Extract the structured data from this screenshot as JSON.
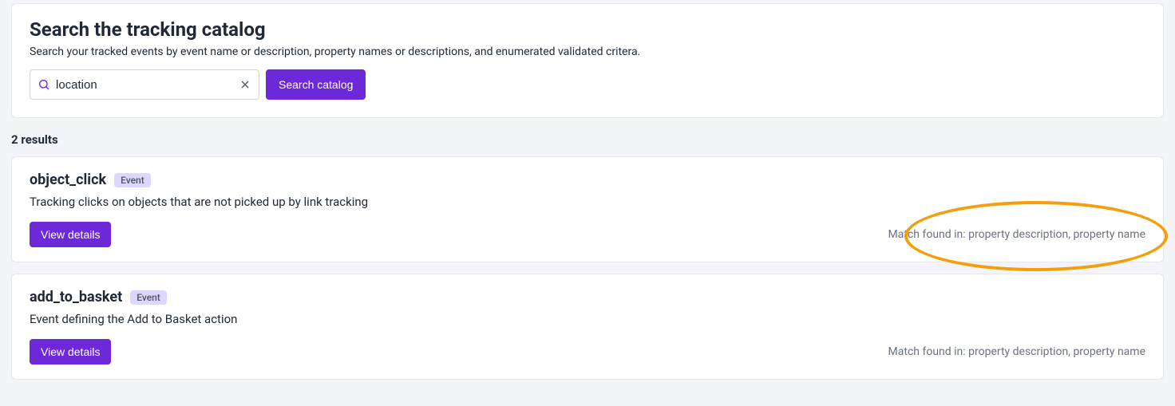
{
  "search": {
    "title": "Search the tracking catalog",
    "subtitle": "Search your tracked events by event name or description, property names or descriptions, and enumerated validated critera.",
    "value": "location",
    "placeholder": "",
    "button": "Search catalog"
  },
  "results_count": "2 results",
  "results": [
    {
      "name": "object_click",
      "badge": "Event",
      "description": "Tracking clicks on objects that are not picked up by link tracking",
      "view_label": "View details",
      "match": "Match found in: property description, property name",
      "highlighted": true
    },
    {
      "name": "add_to_basket",
      "badge": "Event",
      "description": "Event defining the Add to Basket action",
      "view_label": "View details",
      "match": "Match found in: property description, property name",
      "highlighted": false
    }
  ]
}
